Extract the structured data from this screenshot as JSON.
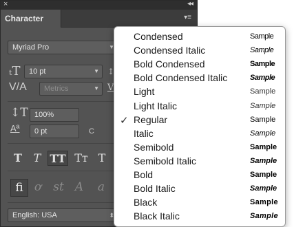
{
  "panel": {
    "close_glyph": "×",
    "collapse_glyph": "◂◂",
    "tab_label": "Character",
    "menu_glyph": "▾≡",
    "font_family": "Myriad Pro",
    "font_size": "10 pt",
    "kerning": "Metrics",
    "vertical_scale": "100%",
    "baseline_shift": "0 pt",
    "color_label": "C",
    "language": "English: USA",
    "type_styles": [
      "T",
      "T",
      "TT",
      "Tт",
      "T"
    ],
    "ligature_glyphs": [
      "fi",
      "ơ",
      "st",
      "A",
      "a"
    ]
  },
  "menu": {
    "selected": "Regular",
    "check_glyph": "✓",
    "items": [
      {
        "label": "Condensed",
        "sample": "Sample"
      },
      {
        "label": "Condensed Italic",
        "sample": "Sample"
      },
      {
        "label": "Bold Condensed",
        "sample": "Sample"
      },
      {
        "label": "Bold Condensed Italic",
        "sample": "Sample"
      },
      {
        "label": "Light",
        "sample": "Sample"
      },
      {
        "label": "Light Italic",
        "sample": "Sample"
      },
      {
        "label": "Regular",
        "sample": "Sample"
      },
      {
        "label": "Italic",
        "sample": "Sample"
      },
      {
        "label": "Semibold",
        "sample": "Sample"
      },
      {
        "label": "Semibold Italic",
        "sample": "Sample"
      },
      {
        "label": "Bold",
        "sample": "Sample"
      },
      {
        "label": "Bold Italic",
        "sample": "Sample"
      },
      {
        "label": "Black",
        "sample": "Sample"
      },
      {
        "label": "Black Italic",
        "sample": "Sample"
      }
    ]
  }
}
